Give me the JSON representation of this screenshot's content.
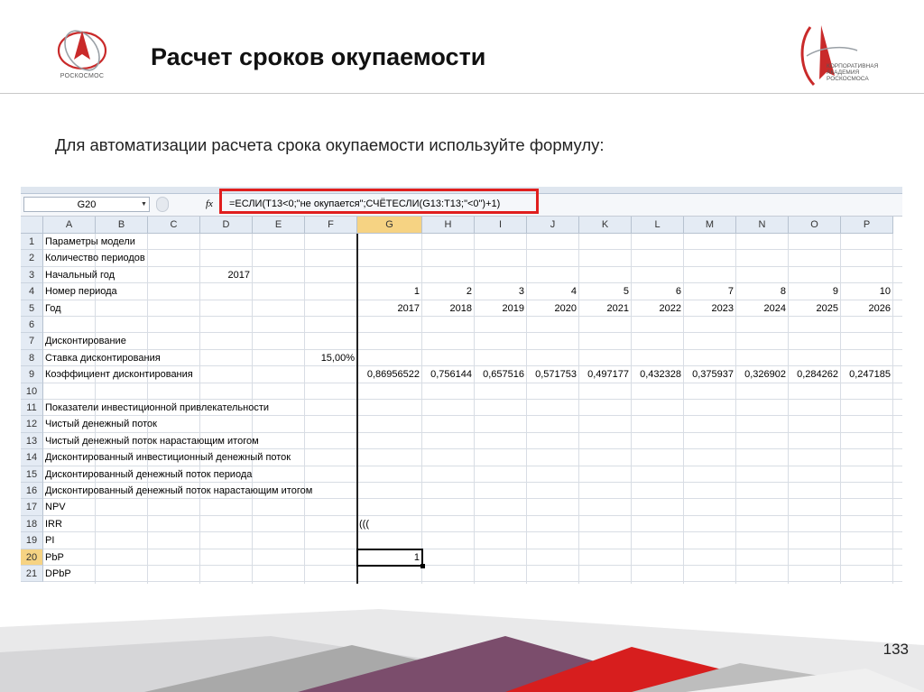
{
  "header": {
    "title": "Расчет сроков окупаемости",
    "left_logo_text": "РОСКОСМОС",
    "right_logo_text": [
      "КОРПОРАТИВНАЯ",
      "АКАДЕМИЯ",
      "РОСКОСМОСА"
    ]
  },
  "subtitle": "Для автоматизации расчета срока окупаемости используйте формулу:",
  "formula_bar": {
    "name_box": "G20",
    "fx": "fx",
    "formula": "=ЕСЛИ(T13<0;\"не окупается\";СЧЁТЕСЛИ(G13:T13;\"<0\")+1)"
  },
  "sheet": {
    "columns": [
      "A",
      "B",
      "C",
      "D",
      "E",
      "F",
      "G",
      "H",
      "I",
      "J",
      "K",
      "L",
      "M",
      "N",
      "O",
      "P"
    ],
    "selected_column": "G",
    "selected_row": "20",
    "rows": [
      {
        "n": "1",
        "A": "Параметры модели"
      },
      {
        "n": "2",
        "A": "Количество периодов"
      },
      {
        "n": "3",
        "A": "Начальный год",
        "D": "2017"
      },
      {
        "n": "4",
        "A": "Номер периода",
        "G": "1",
        "H": "2",
        "I": "3",
        "J": "4",
        "K": "5",
        "L": "6",
        "M": "7",
        "N": "8",
        "O": "9",
        "P": "10"
      },
      {
        "n": "5",
        "A": "Год",
        "G": "2017",
        "H": "2018",
        "I": "2019",
        "J": "2020",
        "K": "2021",
        "L": "2022",
        "M": "2023",
        "N": "2024",
        "O": "2025",
        "P": "2026"
      },
      {
        "n": "6"
      },
      {
        "n": "7",
        "A": "Дисконтирование"
      },
      {
        "n": "8",
        "A": "Ставка дисконтирования",
        "F": "15,00%"
      },
      {
        "n": "9",
        "A": "Коэффициент дисконтирования",
        "G": "0,86956522",
        "H": "0,756144",
        "I": "0,657516",
        "J": "0,571753",
        "K": "0,497177",
        "L": "0,432328",
        "M": "0,375937",
        "N": "0,326902",
        "O": "0,284262",
        "P": "0,247185"
      },
      {
        "n": "10"
      },
      {
        "n": "11",
        "A": "Показатели инвестиционной привлекательности"
      },
      {
        "n": "12",
        "A": "Чистый денежный поток"
      },
      {
        "n": "13",
        "A": "Чистый денежный поток нарастающим итогом"
      },
      {
        "n": "14",
        "A": "Дисконтированный инвестиционный денежный поток"
      },
      {
        "n": "15",
        "A": "Дисконтированный денежный поток периода"
      },
      {
        "n": "16",
        "A": "Дисконтированный денежный поток нарастающим итогом"
      },
      {
        "n": "17",
        "A": "NPV"
      },
      {
        "n": "18",
        "A": "IRR",
        "G": "(((",
        "G_align": "left"
      },
      {
        "n": "19",
        "A": "PI"
      },
      {
        "n": "20",
        "A": "PbP",
        "G": "1"
      },
      {
        "n": "21",
        "A": "DPbP"
      }
    ]
  },
  "page_number": "133",
  "colors": {
    "accent_red": "#e01e1e",
    "band_purple": "#7b4d6c",
    "band_red": "#d71e1e",
    "band_gray": "#a9a9a9"
  }
}
